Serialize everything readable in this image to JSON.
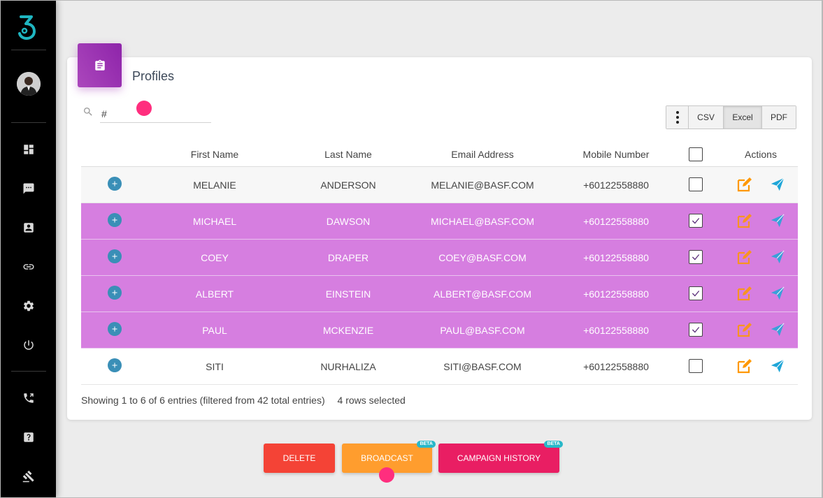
{
  "sidebar": {
    "logo": "3",
    "items": [
      {
        "icon": "dashboard-icon"
      },
      {
        "icon": "chat-icon"
      },
      {
        "icon": "contact-card-icon"
      },
      {
        "icon": "link-icon"
      },
      {
        "icon": "gear-icon"
      },
      {
        "icon": "power-icon"
      },
      {
        "icon": "phone-icon"
      },
      {
        "icon": "help-icon"
      },
      {
        "icon": "gavel-icon"
      }
    ]
  },
  "card": {
    "title": "Profiles",
    "badge_icon": "clipboard-icon",
    "badge_color": "#9c27b0"
  },
  "search": {
    "value": "#",
    "placeholder": ""
  },
  "export": {
    "menu_icon": "more-vertical-icon",
    "buttons": [
      "CSV",
      "Excel",
      "PDF"
    ]
  },
  "table": {
    "headers": [
      "First Name",
      "Last Name",
      "Email Address",
      "Mobile Number",
      "Actions"
    ],
    "rows": [
      {
        "first": "MELANIE",
        "last": "ANDERSON",
        "email": "MELANIE@BASF.COM",
        "mobile": "+60122558880",
        "selected": false
      },
      {
        "first": "MICHAEL",
        "last": "DAWSON",
        "email": "MICHAEL@BASF.COM",
        "mobile": "+60122558880",
        "selected": true
      },
      {
        "first": "COEY",
        "last": "DRAPER",
        "email": "COEY@BASF.COM",
        "mobile": "+60122558880",
        "selected": true
      },
      {
        "first": "ALBERT",
        "last": "EINSTEIN",
        "email": "ALBERT@BASF.COM",
        "mobile": "+60122558880",
        "selected": true
      },
      {
        "first": "PAUL",
        "last": "MCKENZIE",
        "email": "PAUL@BASF.COM",
        "mobile": "+60122558880",
        "selected": true
      },
      {
        "first": "SITI",
        "last": "NURHALIZA",
        "email": "SITI@BASF.COM",
        "mobile": "+60122558880",
        "selected": false
      }
    ]
  },
  "info": {
    "entries": "Showing 1 to 6 of 6 entries (filtered from 42 total entries)",
    "selected": "4 rows selected"
  },
  "actions": {
    "delete": "DELETE",
    "broadcast": "BROADCAST",
    "campaign": "CAMPAIGN HISTORY",
    "beta": "BETA"
  },
  "colors": {
    "selected_row": "#d67ee0",
    "edit": "#ff9800",
    "send": "#1fa6d8",
    "delete": "#f44336",
    "broadcast": "#ff9d2e",
    "campaign": "#e91e63",
    "touch_dot": "#ff2e7e"
  }
}
